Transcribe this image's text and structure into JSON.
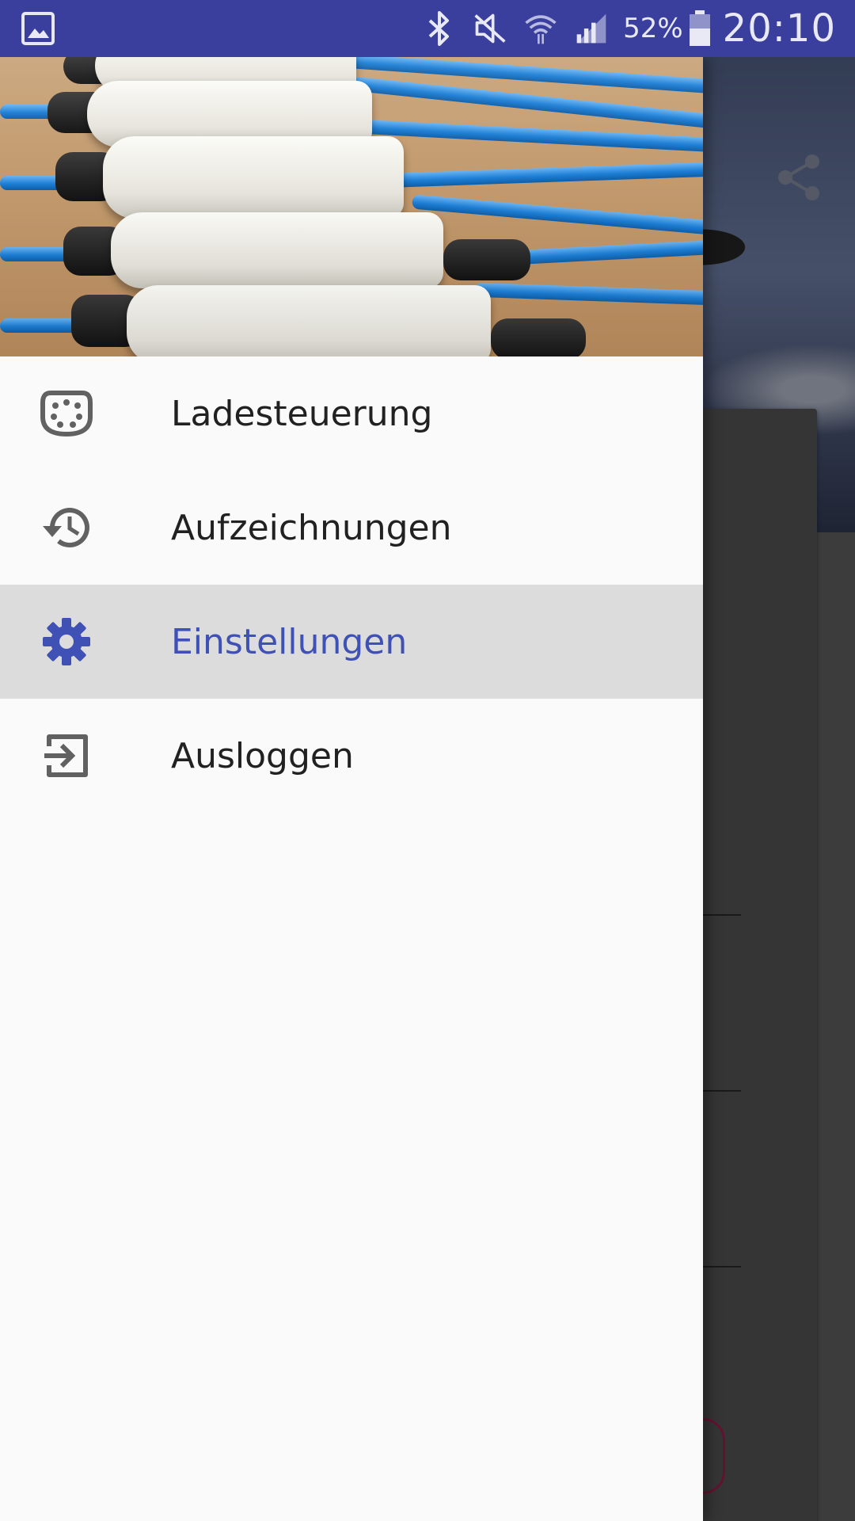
{
  "status_bar": {
    "battery_percent": "52%",
    "time": "20:10",
    "left_icons": [
      "gallery-icon"
    ],
    "right_icons": [
      "bluetooth-icon",
      "mute-icon",
      "wifi-icon",
      "signal-icon",
      "battery-icon"
    ]
  },
  "drawer": {
    "menu": [
      {
        "label": "Ladesteuerung",
        "icon": "connector-icon",
        "selected": false
      },
      {
        "label": "Aufzeichnungen",
        "icon": "history-icon",
        "selected": false
      },
      {
        "label": "Einstellungen",
        "icon": "gear-icon",
        "selected": true
      },
      {
        "label": "Ausloggen",
        "icon": "logout-icon",
        "selected": false
      }
    ]
  },
  "background_app": {
    "toolbar_icons": [
      "share-icon"
    ]
  },
  "colors": {
    "status_bar": "#3a3f9d",
    "accent": "#3f51b5",
    "drawer_bg": "#fafafa",
    "selected_bg": "#dcdcdc",
    "icon_gray": "#616161",
    "outline_button": "#b3245a"
  }
}
